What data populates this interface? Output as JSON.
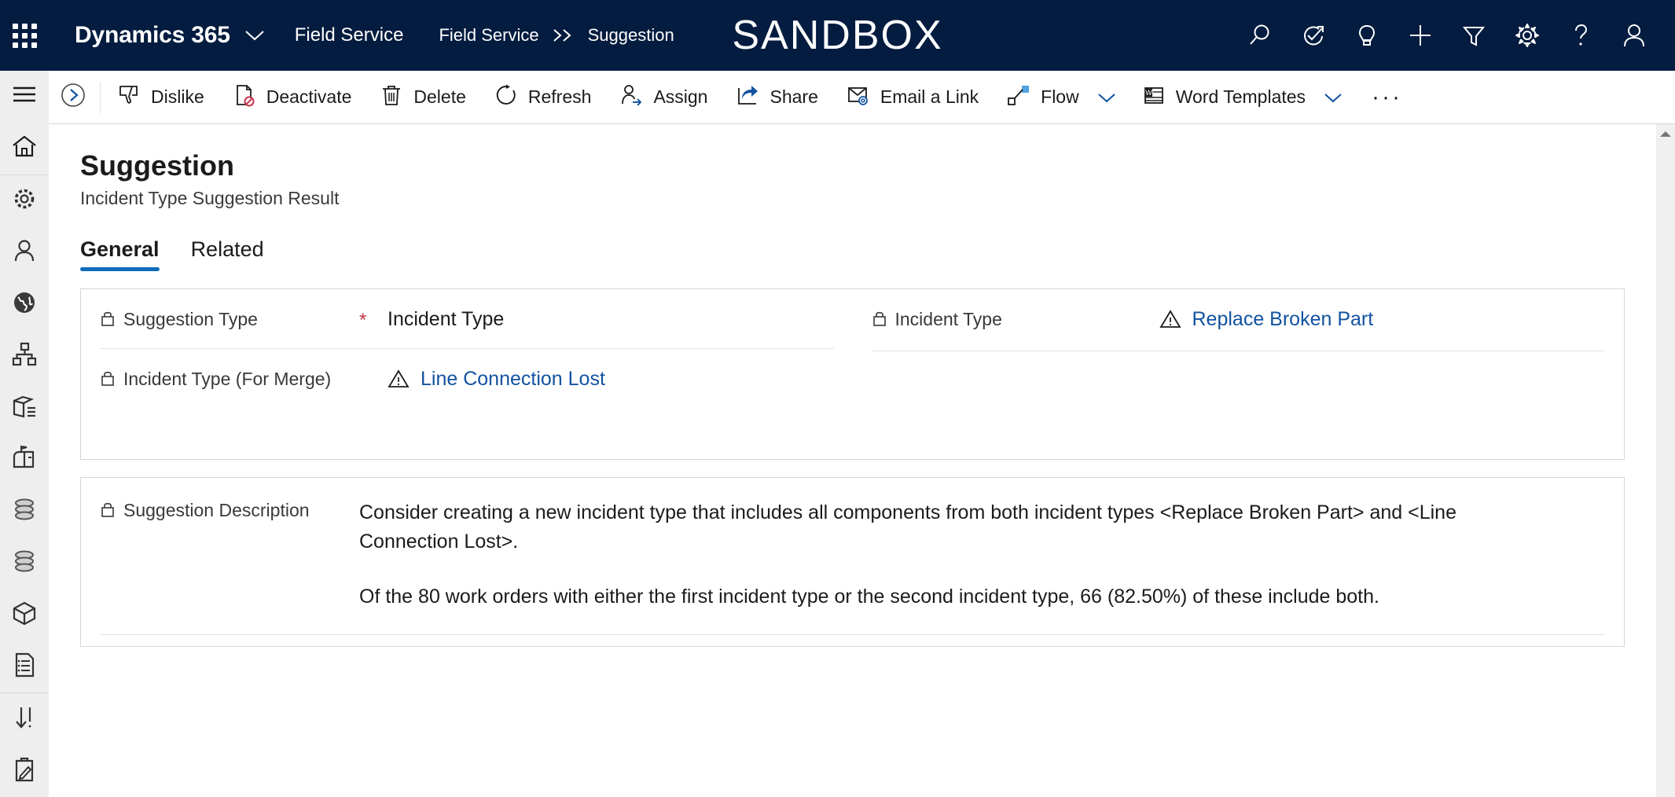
{
  "topbar": {
    "waffle_icon": "app-launcher-icon",
    "brand": "Dynamics 365",
    "brand_caret_icon": "chevron-down-icon",
    "app_name": "Field Service",
    "breadcrumb": {
      "root": "Field Service",
      "separator": ">>",
      "current": "Suggestion"
    },
    "environment_banner": "SANDBOX",
    "icons": [
      {
        "name": "search-icon",
        "label": "Search"
      },
      {
        "name": "diagnostics-icon",
        "label": "Quick Launch"
      },
      {
        "name": "lightbulb-icon",
        "label": "Ideas"
      },
      {
        "name": "plus-icon",
        "label": "New"
      },
      {
        "name": "filter-icon",
        "label": "Filter"
      },
      {
        "name": "gear-icon",
        "label": "Settings"
      },
      {
        "name": "help-icon",
        "label": "Help"
      },
      {
        "name": "user-avatar-icon",
        "label": "Account"
      }
    ]
  },
  "rail": {
    "items": [
      {
        "name": "hamburger-menu-icon",
        "label": "Site Map"
      },
      {
        "name": "home-icon",
        "label": "Home"
      },
      {
        "name": "gear-icon",
        "label": "Settings"
      },
      {
        "name": "person-icon",
        "label": "Accounts"
      },
      {
        "name": "globe-icon",
        "label": "Territories"
      },
      {
        "name": "hierarchy-icon",
        "label": "Organization"
      },
      {
        "name": "box-list-icon",
        "label": "Products"
      },
      {
        "name": "mailbox-icon",
        "label": "Mailbox"
      },
      {
        "name": "database-icon",
        "label": "Data 1"
      },
      {
        "name": "database-icon",
        "label": "Data 2"
      },
      {
        "name": "cube-icon",
        "label": "Inventory"
      },
      {
        "name": "document-list-icon",
        "label": "Reports"
      },
      {
        "name": "sort-down-icon",
        "label": "Sort"
      },
      {
        "name": "clipboard-edit-icon",
        "label": "Tasks"
      }
    ]
  },
  "commandbar": {
    "expand_icon": "chevron-right-circle-icon",
    "buttons": [
      {
        "icon": "thumbs-down-icon",
        "label": "Dislike"
      },
      {
        "icon": "deactivate-icon",
        "label": "Deactivate"
      },
      {
        "icon": "trash-icon",
        "label": "Delete"
      },
      {
        "icon": "refresh-icon",
        "label": "Refresh"
      },
      {
        "icon": "assign-person-icon",
        "label": "Assign"
      },
      {
        "icon": "share-icon",
        "label": "Share"
      },
      {
        "icon": "email-link-icon",
        "label": "Email a Link"
      },
      {
        "icon": "flow-icon",
        "label": "Flow",
        "has_caret": true
      },
      {
        "icon": "word-template-icon",
        "label": "Word Templates",
        "has_caret": true
      }
    ],
    "overflow_label": "···"
  },
  "page": {
    "title": "Suggestion",
    "subtitle": "Incident Type Suggestion Result",
    "tabs": [
      {
        "label": "General",
        "active": true
      },
      {
        "label": "Related",
        "active": false
      }
    ]
  },
  "form": {
    "fields": {
      "suggestion_type": {
        "label": "Suggestion Type",
        "lock_icon": "lock-icon",
        "required_marker": "*",
        "value": "Incident Type"
      },
      "incident_type": {
        "label": "Incident Type",
        "lock_icon": "lock-icon",
        "warning_icon": "warning-triangle-icon",
        "value": "Replace Broken Part"
      },
      "incident_type_merge": {
        "label": "Incident Type (For Merge)",
        "lock_icon": "lock-icon",
        "warning_icon": "warning-triangle-icon",
        "value": "Line Connection Lost"
      },
      "suggestion_description": {
        "label": "Suggestion Description",
        "lock_icon": "lock-icon",
        "paragraphs": [
          "Consider creating a new incident type that includes all components from both incident types <Replace Broken Part> and <Line Connection Lost>.",
          "Of the 80 work orders with either the first incident type or the second incident type, 66 (82.50%) of these include both."
        ]
      }
    }
  },
  "scrollbar": {
    "up_arrow_icon": "caret-up-icon"
  },
  "colors": {
    "nav_background": "#041c3f",
    "accent": "#0f6cbd",
    "link": "#1252a0",
    "required": "#c4314b",
    "rail_background": "#eeeeee"
  }
}
